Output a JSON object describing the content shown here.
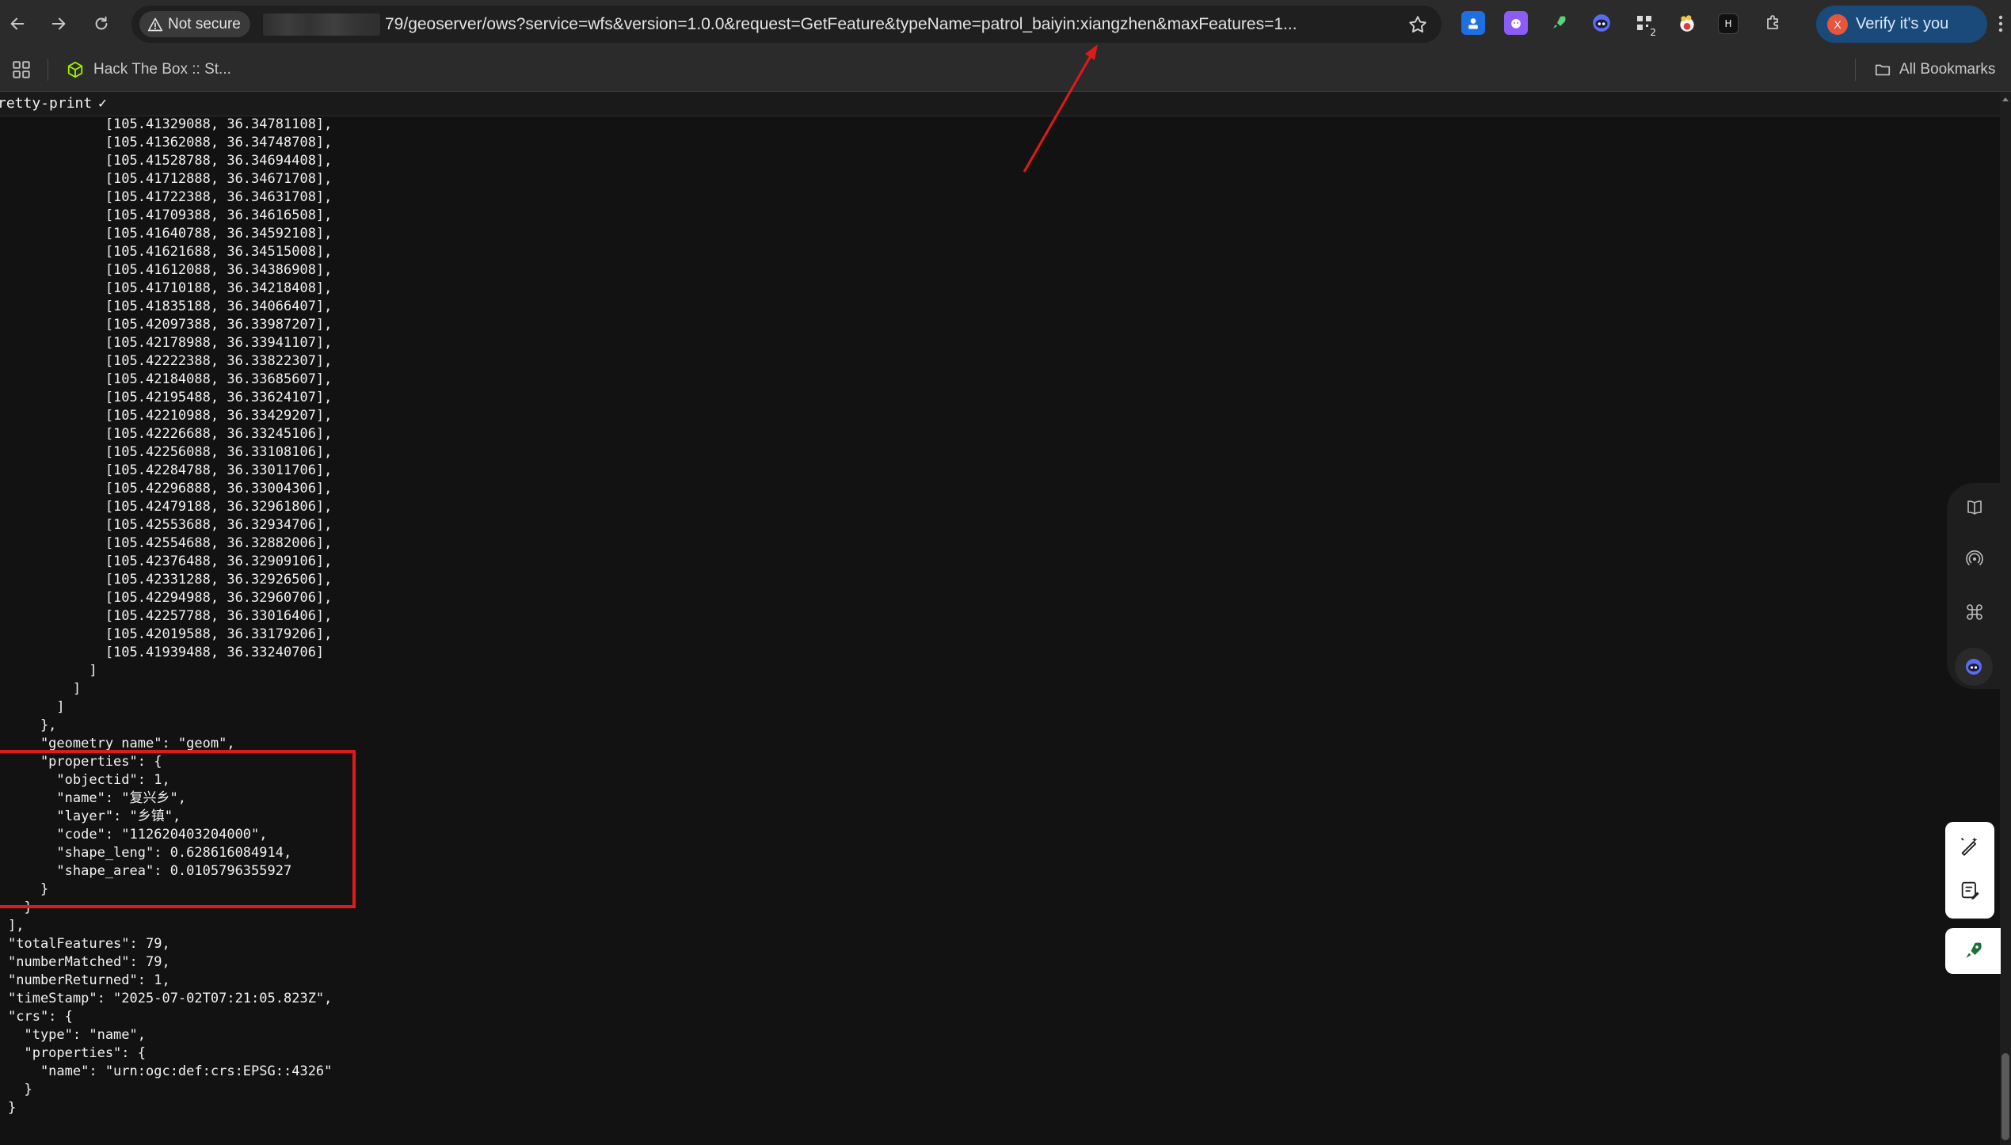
{
  "browser": {
    "security_label": "Not secure",
    "url_visible": "79/geoserver/ows?service=wfs&version=1.0.0&request=GetFeature&typeName=patrol_baiyin:xiangzhen&maxFeatures=1...",
    "profile_label": "Verify it's you",
    "profile_initial": "X",
    "extension_badge": "2",
    "extension_letter": "H"
  },
  "bookmarks": {
    "items": [
      {
        "label": "Hack The Box :: St...",
        "icon": "hackthebox-cube-icon"
      }
    ],
    "all_bookmarks_label": "All Bookmarks"
  },
  "viewer": {
    "pretty_print_label": "retty-print",
    "pretty_print_check": "✓"
  },
  "json_lines": [
    "            [105.41329088, 36.34781108],",
    "            [105.41362088, 36.34748708],",
    "            [105.41528788, 36.34694408],",
    "            [105.41712888, 36.34671708],",
    "            [105.41722388, 36.34631708],",
    "            [105.41709388, 36.34616508],",
    "            [105.41640788, 36.34592108],",
    "            [105.41621688, 36.34515008],",
    "            [105.41612088, 36.34386908],",
    "            [105.41710188, 36.34218408],",
    "            [105.41835188, 36.34066407],",
    "            [105.42097388, 36.33987207],",
    "            [105.42178988, 36.33941107],",
    "            [105.42222388, 36.33822307],",
    "            [105.42184088, 36.33685607],",
    "            [105.42195488, 36.33624107],",
    "            [105.42210988, 36.33429207],",
    "            [105.42226688, 36.33245106],",
    "            [105.42256088, 36.33108106],",
    "            [105.42284788, 36.33011706],",
    "            [105.42296888, 36.33004306],",
    "            [105.42479188, 36.32961806],",
    "            [105.42553688, 36.32934706],",
    "            [105.42554688, 36.32882006],",
    "            [105.42376488, 36.32909106],",
    "            [105.42331288, 36.32926506],",
    "            [105.42294988, 36.32960706],",
    "            [105.42257788, 36.33016406],",
    "            [105.42019588, 36.33179206],",
    "            [105.41939488, 36.33240706]",
    "          ]",
    "        ]",
    "      ]",
    "    },",
    "    \"geometry_name\": \"geom\",",
    "    \"properties\": {",
    "      \"objectid\": 1,",
    "      \"name\": \"复兴乡\",",
    "      \"layer\": \"乡镇\",",
    "      \"code\": \"112620403204000\",",
    "      \"shape_leng\": 0.628616084914,",
    "      \"shape_area\": 0.0105796355927",
    "    }",
    "  }",
    "],",
    "\"totalFeatures\": 79,",
    "\"numberMatched\": 79,",
    "\"numberReturned\": 1,",
    "\"timeStamp\": \"2025-07-02T07:21:05.823Z\",",
    "\"crs\": {",
    "  \"type\": \"name\",",
    "  \"properties\": {",
    "    \"name\": \"urn:ogc:def:crs:EPSG::4326\"",
    "  }",
    "}"
  ],
  "colors": {
    "annotation_red": "#e01a1a",
    "profile_blue": "#1a4a7a",
    "page_background": "#121212"
  }
}
